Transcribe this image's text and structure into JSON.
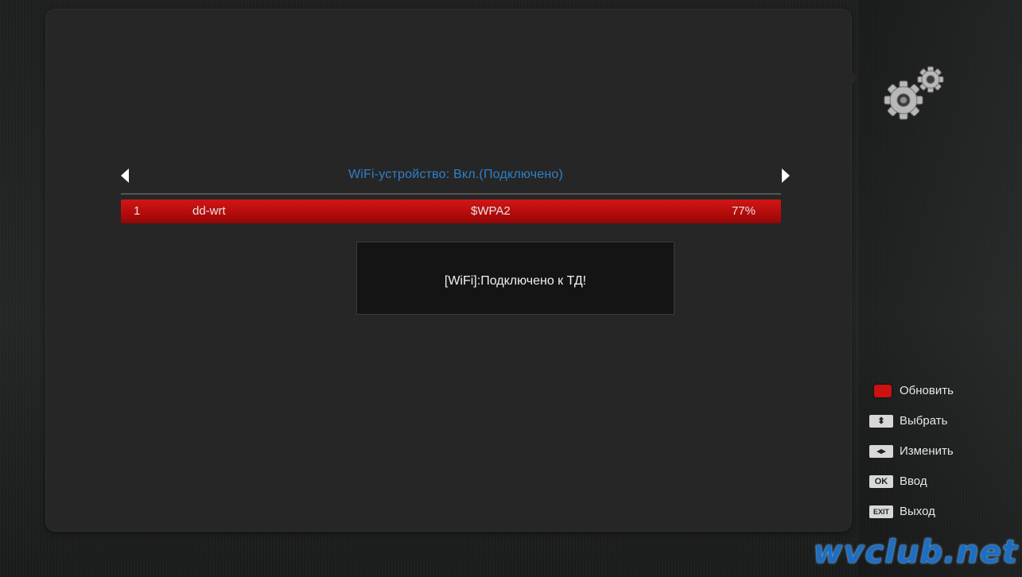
{
  "wifi": {
    "status_title": "WiFi-устройство: Вкл.(Подключено)",
    "access_points": [
      {
        "index": "1",
        "ssid": "dd-wrt",
        "security": "$WPA2",
        "signal": "77%"
      }
    ]
  },
  "dialog": {
    "message": "[WiFi]:Подключено к ТД!"
  },
  "legend": {
    "items": [
      {
        "key_label": "",
        "key_color": "#cc1111",
        "label": "Обновить"
      },
      {
        "key_label": "⬍",
        "label": "Выбрать"
      },
      {
        "key_label": "◂▸",
        "label": "Изменить"
      },
      {
        "key_label": "OK",
        "label": "Ввод"
      },
      {
        "key_label": "EXIT",
        "label": "Выход"
      }
    ]
  },
  "watermark": "wvclub.net",
  "icons": {
    "settings": "gears-icon",
    "nav_left": "arrow-left-icon",
    "nav_right": "arrow-right-icon"
  },
  "colors": {
    "title": "#2f80c9",
    "selection": "#c41010",
    "panel": "#262626"
  }
}
